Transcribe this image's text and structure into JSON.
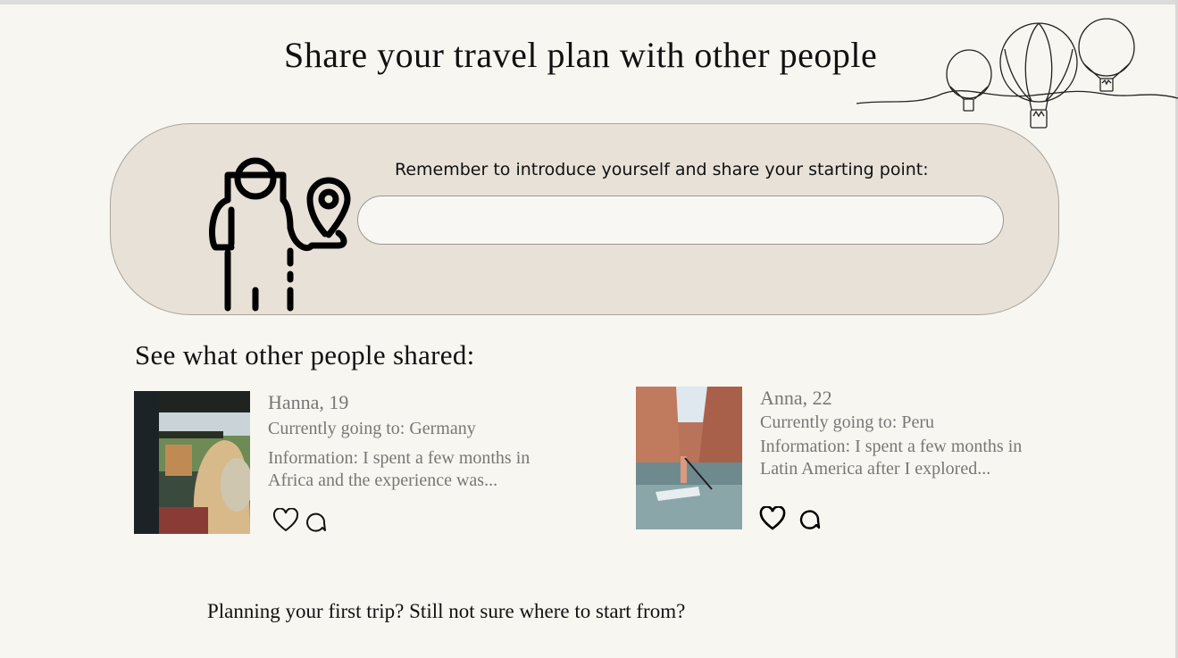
{
  "page": {
    "title": "Share your travel plan with other people"
  },
  "share_form": {
    "prompt": "Remember to introduce yourself and share your starting point:",
    "input_value": "",
    "input_placeholder": ""
  },
  "feed": {
    "heading": "See what other people shared:",
    "posts": [
      {
        "name_age": "Hanna, 19",
        "destination": "Currently going to: Germany",
        "information": "Information: I spent a few months in Africa and the experience was...",
        "photo": "safari-photo",
        "actions": [
          "heart-icon",
          "comment-icon"
        ]
      },
      {
        "name_age": "Anna, 22",
        "destination": "Currently going to: Peru",
        "information": "Information: I spent a few months in Latin America after I explored...",
        "photo": "paddleboard-canyon-photo",
        "actions": [
          "heart-icon",
          "comment-icon"
        ]
      }
    ]
  },
  "footer": {
    "question": "Planning your first trip? Still not sure where to start from?"
  },
  "colors": {
    "background": "#f7f6f1",
    "panel": "#e7e1d8",
    "muted_text": "#777777"
  }
}
